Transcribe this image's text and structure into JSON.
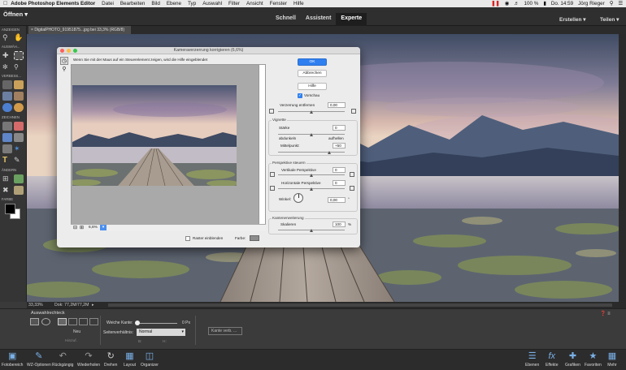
{
  "menubar": {
    "app": "Adobe Photoshop Elements Editor",
    "items": [
      "Datei",
      "Bearbeiten",
      "Bild",
      "Ebene",
      "Typ",
      "Auswahl",
      "Filter",
      "Ansicht",
      "Fenster",
      "Hilfe"
    ],
    "clock": "Do. 14:59",
    "user": "Jörg Rieger",
    "battery": "100 %"
  },
  "appbar": {
    "open": "Öffnen",
    "modes": [
      "Schnell",
      "Assistent",
      "Experte"
    ],
    "active_mode": "Experte",
    "create": "Erstellen",
    "share": "Teilen"
  },
  "toolbox": {
    "sections": [
      "ANZEIGEN",
      "AUSWÄH...",
      "VERBESS...",
      "ZEICHNEN",
      "ÄNDERN",
      "FARBE"
    ]
  },
  "document": {
    "tab": "DigitalPHOTO_91951875...jpg bei 33,3% (RGB/8)",
    "zoom": "33,33%",
    "doc_info": "Dok: 77,2M/77,2M"
  },
  "dialog": {
    "title": "Kameraverzerrung korrigieren (6,6%)",
    "hint": "Wenn Sie mit der Maus auf ein Steuerelement zeigen, wird die Hilfe eingeblendet",
    "ok": "OK",
    "cancel": "Abbrechen",
    "help": "Hilfe",
    "preview_label": "Vorschau",
    "distortion": {
      "label": "Verzerrung entfernen",
      "value": "0,00"
    },
    "vignette": {
      "title": "Vignette",
      "strength": "Stärke",
      "strength_value": "0",
      "darken": "abdunkeln",
      "lighten": "aufhellen",
      "midpoint": "Mittelpunkt:",
      "midpoint_value": "+50"
    },
    "perspective": {
      "title": "Perspektive steuern",
      "vertical": "Vertikale Perspektive",
      "vertical_value": "0",
      "horizontal": "Horizontale Perspektive",
      "horizontal_value": "0",
      "angle": "Winkel:",
      "angle_value": "0,00",
      "degree": "°"
    },
    "edge": {
      "title": "Kantenerweiterung",
      "scale": "Skalieren",
      "scale_value": "100",
      "unit": "%"
    },
    "zoom_value": "6,6%",
    "grid_label": "Raster einblenden",
    "color_label": "Farbe:"
  },
  "options": {
    "tool": "Auswahlrechteck",
    "new": "Neu",
    "add": "Hinzuf.",
    "feather_label": "Weiche Kante:",
    "feather_value": "0 Px",
    "aspect_label": "Seitenverhältnis:",
    "aspect_value": "Normal",
    "b_label": "B:",
    "h_label": "H:",
    "refine": "Kante verb. ..."
  },
  "bottombar": {
    "left": [
      "Fotobereich",
      "WZ-Optionen",
      "Rückgängig",
      "Wiederholen",
      "Drehen",
      "Layout",
      "Organizer"
    ],
    "right": [
      "Ebenen",
      "Effekte",
      "Grafiken",
      "Favoriten",
      "Mehr"
    ]
  },
  "colors": {
    "accent": "#2f7ff0",
    "panel": "#353535",
    "dialog": "#ececec"
  }
}
